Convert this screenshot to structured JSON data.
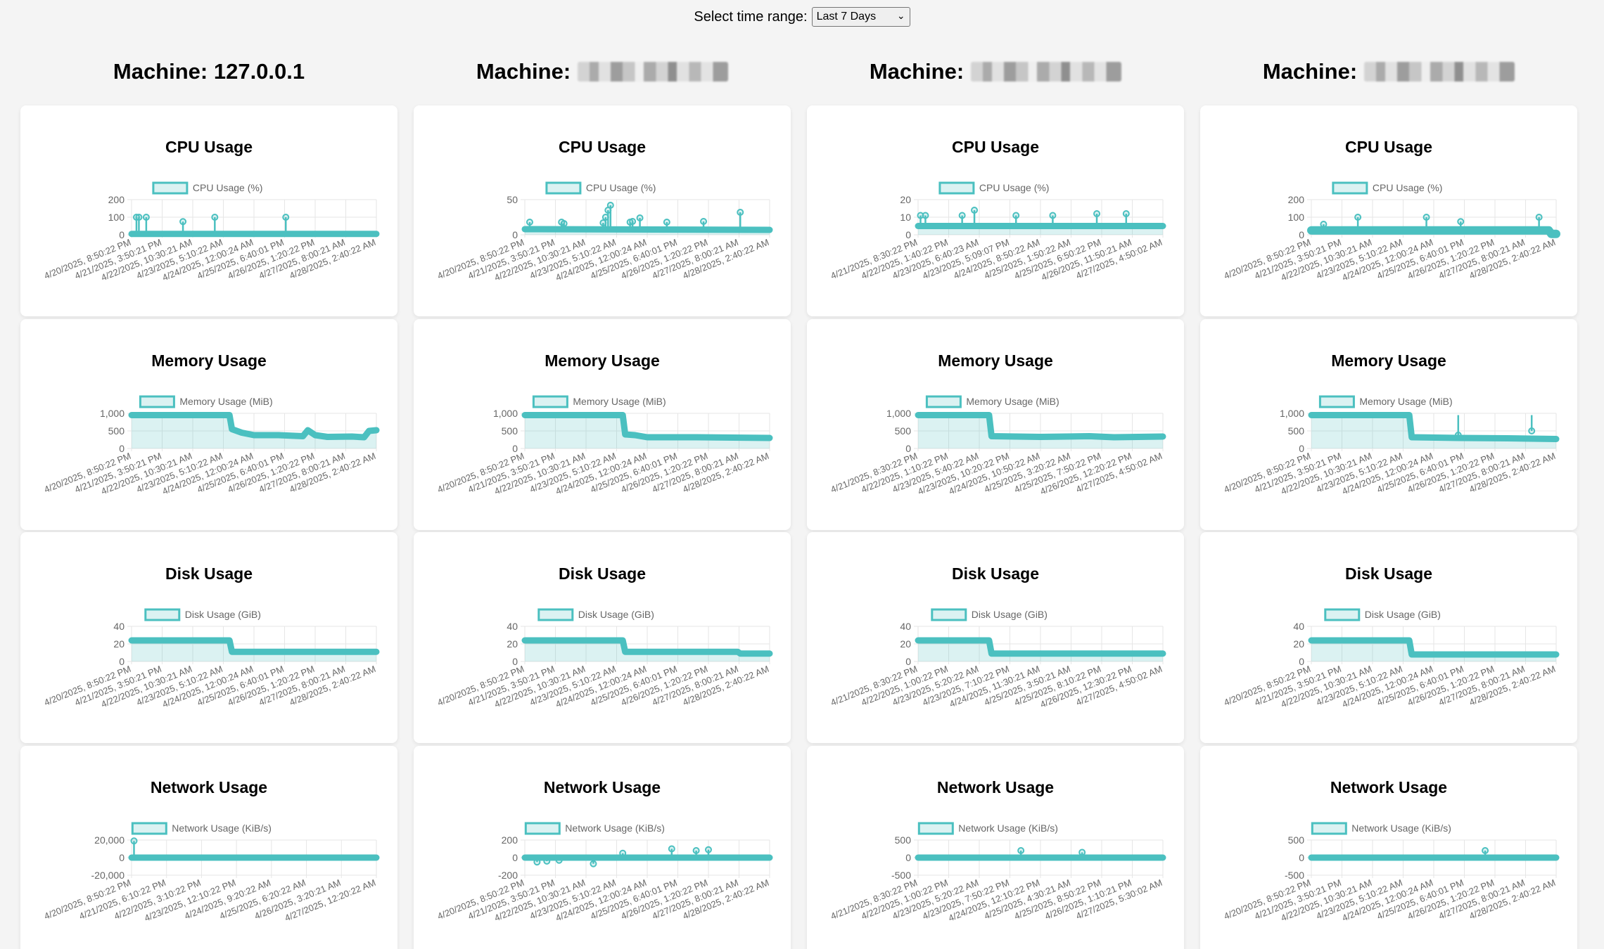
{
  "range": {
    "label": "Select time range:",
    "selected": "Last 7 Days",
    "chevron_icon": "chevron-down-icon"
  },
  "machines": [
    {
      "title": "Machine: 127.0.0.1",
      "host": "127.0.0.1",
      "masked": false
    },
    {
      "title": "Machine:",
      "host": "",
      "masked": true
    },
    {
      "title": "Machine:",
      "host": "",
      "masked": true
    },
    {
      "title": "Machine:",
      "host": "",
      "masked": true
    }
  ],
  "colors": {
    "line": "#4bc0c0",
    "fill": "rgba(75,192,192,0.2)",
    "grid": "#e6e6e6",
    "axis_text": "#666666"
  },
  "charts": {
    "cpu": {
      "title": "CPU Usage",
      "legend": "CPU Usage (%)"
    },
    "memory": {
      "title": "Memory Usage",
      "legend": "Memory Usage (MiB)"
    },
    "disk": {
      "title": "Disk Usage",
      "legend": "Disk Usage (GiB)"
    },
    "network": {
      "title": "Network Usage",
      "legend": "Network Usage (KiB/s)"
    }
  },
  "chart_data": [
    {
      "machine": 0,
      "metric": "cpu",
      "type": "line",
      "ylim": [
        0,
        200
      ],
      "yticks": [
        "200",
        "100",
        "0"
      ],
      "tick_values": [
        200,
        100,
        0
      ],
      "xticks": [
        "4/20/2025, 8:50:22 PM",
        "4/21/2025, 3:50:21 PM",
        "4/22/2025, 10:30:21 AM",
        "4/23/2025, 5:10:22 AM",
        "4/24/2025, 12:00:24 AM",
        "4/25/2025, 6:40:01 PM",
        "4/26/2025, 1:20:22 PM",
        "4/27/2025, 8:00:21 AM",
        "4/28/2025, 2:40:22 AM"
      ],
      "base": [
        [
          0,
          5
        ],
        [
          1,
          5
        ]
      ],
      "spikes": [
        [
          0.02,
          100
        ],
        [
          0.03,
          100
        ],
        [
          0.06,
          100
        ],
        [
          0.21,
          75
        ],
        [
          0.34,
          100
        ],
        [
          0.63,
          100
        ]
      ]
    },
    {
      "machine": 1,
      "metric": "cpu",
      "type": "line",
      "ylim": [
        0,
        50
      ],
      "yticks": [
        "50",
        "0"
      ],
      "tick_values": [
        50,
        0
      ],
      "xticks": [
        "4/20/2025, 8:50:22 PM",
        "4/21/2025, 3:50:21 PM",
        "4/22/2025, 10:30:21 AM",
        "4/23/2025, 5:10:22 AM",
        "4/24/2025, 12:00:24 AM",
        "4/25/2025, 6:40:01 PM",
        "4/26/2025, 1:20:22 PM",
        "4/27/2025, 8:00:21 AM",
        "4/28/2025, 2:40:22 AM"
      ],
      "base": [
        [
          0,
          8
        ],
        [
          1,
          7
        ]
      ],
      "spikes": [
        [
          0.02,
          18
        ],
        [
          0.15,
          18
        ],
        [
          0.16,
          16
        ],
        [
          0.32,
          17
        ],
        [
          0.33,
          25
        ],
        [
          0.34,
          35
        ],
        [
          0.35,
          42
        ],
        [
          0.43,
          18
        ],
        [
          0.44,
          19
        ],
        [
          0.47,
          24
        ],
        [
          0.58,
          18
        ],
        [
          0.73,
          19
        ],
        [
          0.88,
          32
        ]
      ]
    },
    {
      "machine": 2,
      "metric": "cpu",
      "type": "line",
      "ylim": [
        0,
        20
      ],
      "yticks": [
        "20",
        "10",
        "0"
      ],
      "tick_values": [
        20,
        10,
        0
      ],
      "xticks": [
        "4/21/2025, 8:30:22 PM",
        "4/22/2025, 1:40:22 PM",
        "4/23/2025, 6:40:23 AM",
        "4/23/2025, 5:09:07 PM",
        "4/24/2025, 8:50:22 AM",
        "4/25/2025, 1:50:22 AM",
        "4/25/2025, 6:50:22 PM",
        "4/26/2025, 11:50:21 AM",
        "4/27/2025, 4:50:02 AM"
      ],
      "base": [
        [
          0,
          5
        ],
        [
          1,
          5
        ]
      ],
      "spikes": [
        [
          0.01,
          11
        ],
        [
          0.03,
          11
        ],
        [
          0.18,
          11
        ],
        [
          0.23,
          14
        ],
        [
          0.4,
          11
        ],
        [
          0.55,
          11
        ],
        [
          0.73,
          12
        ],
        [
          0.85,
          12
        ]
      ]
    },
    {
      "machine": 3,
      "metric": "cpu",
      "type": "line",
      "ylim": [
        0,
        200
      ],
      "yticks": [
        "200",
        "100",
        "0"
      ],
      "tick_values": [
        200,
        100,
        0
      ],
      "xticks": [
        "4/20/2025, 8:50:22 PM",
        "4/21/2025, 3:50:21 PM",
        "4/22/2025, 10:30:21 AM",
        "4/23/2025, 5:10:22 AM",
        "4/24/2025, 12:00:24 AM",
        "4/25/2025, 6:40:01 PM",
        "4/26/2025, 1:20:22 PM",
        "4/27/2025, 8:00:21 AM",
        "4/28/2025, 2:40:22 AM"
      ],
      "base": [
        [
          0,
          25
        ],
        [
          0.97,
          25
        ],
        [
          0.98,
          5
        ],
        [
          1,
          5
        ]
      ],
      "spikes": [
        [
          0.05,
          60
        ],
        [
          0.19,
          100
        ],
        [
          0.47,
          100
        ],
        [
          0.61,
          75
        ],
        [
          0.93,
          100
        ]
      ]
    },
    {
      "machine": 0,
      "metric": "memory",
      "type": "area",
      "ylim": [
        0,
        1000
      ],
      "yticks": [
        "1,000",
        "500",
        "0"
      ],
      "tick_values": [
        1000,
        500,
        0
      ],
      "xticks": [
        "4/20/2025, 8:50:22 PM",
        "4/21/2025, 3:50:21 PM",
        "4/22/2025, 10:30:21 AM",
        "4/23/2025, 5:10:22 AM",
        "4/24/2025, 12:00:24 AM",
        "4/25/2025, 6:40:01 PM",
        "4/26/2025, 1:20:22 PM",
        "4/27/2025, 8:00:21 AM",
        "4/28/2025, 2:40:22 AM"
      ],
      "base": [
        [
          0,
          950
        ],
        [
          0.4,
          950
        ],
        [
          0.41,
          550
        ],
        [
          0.45,
          450
        ],
        [
          0.5,
          380
        ],
        [
          0.6,
          380
        ],
        [
          0.7,
          350
        ],
        [
          0.72,
          520
        ],
        [
          0.75,
          380
        ],
        [
          0.8,
          330
        ],
        [
          0.9,
          340
        ],
        [
          0.95,
          320
        ],
        [
          0.97,
          500
        ],
        [
          1,
          520
        ]
      ],
      "spikes": []
    },
    {
      "machine": 1,
      "metric": "memory",
      "type": "area",
      "ylim": [
        0,
        1000
      ],
      "yticks": [
        "1,000",
        "500",
        "0"
      ],
      "tick_values": [
        1000,
        500,
        0
      ],
      "xticks": [
        "4/20/2025, 8:50:22 PM",
        "4/21/2025, 3:50:21 PM",
        "4/22/2025, 10:30:21 AM",
        "4/23/2025, 5:10:22 AM",
        "4/24/2025, 12:00:24 AM",
        "4/25/2025, 6:40:01 PM",
        "4/26/2025, 1:20:22 PM",
        "4/27/2025, 8:00:21 AM",
        "4/28/2025, 2:40:22 AM"
      ],
      "base": [
        [
          0,
          950
        ],
        [
          0.4,
          950
        ],
        [
          0.41,
          400
        ],
        [
          0.45,
          380
        ],
        [
          0.5,
          320
        ],
        [
          0.7,
          320
        ],
        [
          1,
          300
        ]
      ],
      "spikes": []
    },
    {
      "machine": 2,
      "metric": "memory",
      "type": "area",
      "ylim": [
        0,
        1000
      ],
      "yticks": [
        "1,000",
        "500",
        "0"
      ],
      "tick_values": [
        1000,
        500,
        0
      ],
      "xticks": [
        "4/21/2025, 8:30:22 PM",
        "4/22/2025, 1:10:22 PM",
        "4/23/2025, 5:40:22 AM",
        "4/23/2025, 10:20:22 PM",
        "4/24/2025, 10:50:22 AM",
        "4/25/2025, 3:20:22 AM",
        "4/25/2025, 7:50:22 PM",
        "4/26/2025, 12:20:22 PM",
        "4/27/2025, 4:50:02 AM"
      ],
      "base": [
        [
          0,
          950
        ],
        [
          0.29,
          950
        ],
        [
          0.3,
          350
        ],
        [
          0.5,
          330
        ],
        [
          0.7,
          350
        ],
        [
          0.8,
          320
        ],
        [
          1,
          340
        ]
      ],
      "spikes": []
    },
    {
      "machine": 3,
      "metric": "memory",
      "type": "area",
      "ylim": [
        0,
        1000
      ],
      "yticks": [
        "1,000",
        "500",
        "0"
      ],
      "tick_values": [
        1000,
        500,
        0
      ],
      "xticks": [
        "4/20/2025, 8:50:22 PM",
        "4/21/2025, 3:50:21 PM",
        "4/22/2025, 10:30:21 AM",
        "4/23/2025, 5:10:22 AM",
        "4/24/2025, 12:00:24 AM",
        "4/25/2025, 6:40:01 PM",
        "4/26/2025, 1:20:22 PM",
        "4/27/2025, 8:00:21 AM",
        "4/28/2025, 2:40:22 AM"
      ],
      "base": [
        [
          0,
          950
        ],
        [
          0.4,
          950
        ],
        [
          0.41,
          320
        ],
        [
          0.6,
          300
        ],
        [
          0.8,
          290
        ],
        [
          1,
          270
        ]
      ],
      "spikes": [
        [
          0.6,
          380
        ],
        [
          0.9,
          500
        ]
      ]
    },
    {
      "machine": 0,
      "metric": "disk",
      "type": "area",
      "ylim": [
        0,
        40
      ],
      "yticks": [
        "40",
        "20",
        "0"
      ],
      "tick_values": [
        40,
        20,
        0
      ],
      "xticks": [
        "4/20/2025, 8:50:22 PM",
        "4/21/2025, 3:50:21 PM",
        "4/22/2025, 10:30:21 AM",
        "4/23/2025, 5:10:22 AM",
        "4/24/2025, 12:00:24 AM",
        "4/25/2025, 6:40:01 PM",
        "4/26/2025, 1:20:22 PM",
        "4/27/2025, 8:00:21 AM",
        "4/28/2025, 2:40:22 AM"
      ],
      "base": [
        [
          0,
          24
        ],
        [
          0.4,
          24
        ],
        [
          0.41,
          11
        ],
        [
          0.7,
          11
        ],
        [
          1,
          11
        ]
      ],
      "spikes": []
    },
    {
      "machine": 1,
      "metric": "disk",
      "type": "area",
      "ylim": [
        0,
        40
      ],
      "yticks": [
        "40",
        "20",
        "0"
      ],
      "tick_values": [
        40,
        20,
        0
      ],
      "xticks": [
        "4/20/2025, 8:50:22 PM",
        "4/21/2025, 3:50:21 PM",
        "4/22/2025, 10:30:21 AM",
        "4/23/2025, 5:10:22 AM",
        "4/24/2025, 12:00:24 AM",
        "4/25/2025, 6:40:01 PM",
        "4/26/2025, 1:20:22 PM",
        "4/27/2025, 8:00:21 AM",
        "4/28/2025, 2:40:22 AM"
      ],
      "base": [
        [
          0,
          24
        ],
        [
          0.4,
          24
        ],
        [
          0.41,
          11
        ],
        [
          0.87,
          11
        ],
        [
          0.88,
          9
        ],
        [
          1,
          9
        ]
      ],
      "spikes": []
    },
    {
      "machine": 2,
      "metric": "disk",
      "type": "area",
      "ylim": [
        0,
        40
      ],
      "yticks": [
        "40",
        "20",
        "0"
      ],
      "tick_values": [
        40,
        20,
        0
      ],
      "xticks": [
        "4/21/2025, 8:30:22 PM",
        "4/22/2025, 1:00:22 PM",
        "4/23/2025, 5:20:22 AM",
        "4/23/2025, 7:10:22 PM",
        "4/24/2025, 11:30:21 AM",
        "4/25/2025, 3:50:21 AM",
        "4/25/2025, 8:10:22 PM",
        "4/26/2025, 12:30:22 PM",
        "4/27/2025, 4:50:02 AM"
      ],
      "base": [
        [
          0,
          24
        ],
        [
          0.29,
          24
        ],
        [
          0.3,
          9
        ],
        [
          1,
          9
        ]
      ],
      "spikes": []
    },
    {
      "machine": 3,
      "metric": "disk",
      "type": "area",
      "ylim": [
        0,
        40
      ],
      "yticks": [
        "40",
        "20",
        "0"
      ],
      "tick_values": [
        40,
        20,
        0
      ],
      "xticks": [
        "4/20/2025, 8:50:22 PM",
        "4/21/2025, 3:50:21 PM",
        "4/22/2025, 10:30:21 AM",
        "4/23/2025, 5:10:22 AM",
        "4/24/2025, 12:00:24 AM",
        "4/25/2025, 6:40:01 PM",
        "4/26/2025, 1:20:22 PM",
        "4/27/2025, 8:00:21 AM",
        "4/28/2025, 2:40:22 AM"
      ],
      "base": [
        [
          0,
          24
        ],
        [
          0.4,
          24
        ],
        [
          0.41,
          8
        ],
        [
          1,
          8
        ]
      ],
      "spikes": []
    },
    {
      "machine": 0,
      "metric": "network",
      "type": "line",
      "ylim": [
        -20000,
        20000
      ],
      "yticks": [
        "20,000",
        "0",
        "-20,000"
      ],
      "tick_values": [
        20000,
        0,
        -20000
      ],
      "xticks": [
        "4/20/2025, 8:50:22 PM",
        "4/21/2025, 6:10:22 PM",
        "4/22/2025, 3:10:22 PM",
        "4/23/2025, 12:10:22 PM",
        "4/24/2025, 9:20:22 AM",
        "4/25/2025, 6:20:22 AM",
        "4/26/2025, 3:20:21 AM",
        "4/27/2025, 12:20:22 AM"
      ],
      "base": [
        [
          0,
          0
        ],
        [
          1,
          0
        ]
      ],
      "spikes": [
        [
          0.01,
          19000
        ]
      ]
    },
    {
      "machine": 1,
      "metric": "network",
      "type": "line",
      "ylim": [
        -200,
        200
      ],
      "yticks": [
        "200",
        "0",
        "-200"
      ],
      "tick_values": [
        200,
        0,
        -200
      ],
      "xticks": [
        "4/20/2025, 8:50:22 PM",
        "4/21/2025, 3:50:21 PM",
        "4/22/2025, 10:30:21 AM",
        "4/23/2025, 5:10:22 AM",
        "4/24/2025, 12:00:24 AM",
        "4/25/2025, 6:40:01 PM",
        "4/26/2025, 1:20:22 PM",
        "4/27/2025, 8:00:21 AM",
        "4/28/2025, 2:40:22 AM"
      ],
      "base": [
        [
          0,
          0
        ],
        [
          1,
          0
        ]
      ],
      "spikes": [
        [
          0.05,
          -50
        ],
        [
          0.09,
          -40
        ],
        [
          0.14,
          -30
        ],
        [
          0.28,
          -70
        ],
        [
          0.4,
          50
        ],
        [
          0.6,
          100
        ],
        [
          0.7,
          80
        ],
        [
          0.75,
          90
        ]
      ]
    },
    {
      "machine": 2,
      "metric": "network",
      "type": "line",
      "ylim": [
        -500,
        500
      ],
      "yticks": [
        "500",
        "0",
        "-500"
      ],
      "tick_values": [
        500,
        0,
        -500
      ],
      "xticks": [
        "4/21/2025, 8:30:22 PM",
        "4/22/2025, 1:00:22 PM",
        "4/23/2025, 5:20:22 AM",
        "4/23/2025, 7:50:22 PM",
        "4/24/2025, 12:10:22 PM",
        "4/25/2025, 4:30:21 AM",
        "4/25/2025, 8:50:22 PM",
        "4/26/2025, 1:10:21 PM",
        "4/27/2025, 5:30:02 AM"
      ],
      "base": [
        [
          0,
          0
        ],
        [
          1,
          0
        ]
      ],
      "spikes": [
        [
          0.42,
          200
        ],
        [
          0.67,
          150
        ]
      ]
    },
    {
      "machine": 3,
      "metric": "network",
      "type": "line",
      "ylim": [
        -500,
        500
      ],
      "yticks": [
        "500",
        "0",
        "-500"
      ],
      "tick_values": [
        500,
        0,
        -500
      ],
      "xticks": [
        "4/20/2025, 8:50:22 PM",
        "4/21/2025, 3:50:21 PM",
        "4/22/2025, 10:30:21 AM",
        "4/23/2025, 5:10:22 AM",
        "4/24/2025, 12:00:24 AM",
        "4/25/2025, 6:40:01 PM",
        "4/26/2025, 1:20:22 PM",
        "4/27/2025, 8:00:21 AM",
        "4/28/2025, 2:40:22 AM"
      ],
      "base": [
        [
          0,
          0
        ],
        [
          1,
          0
        ]
      ],
      "spikes": [
        [
          0.71,
          200
        ]
      ]
    }
  ]
}
